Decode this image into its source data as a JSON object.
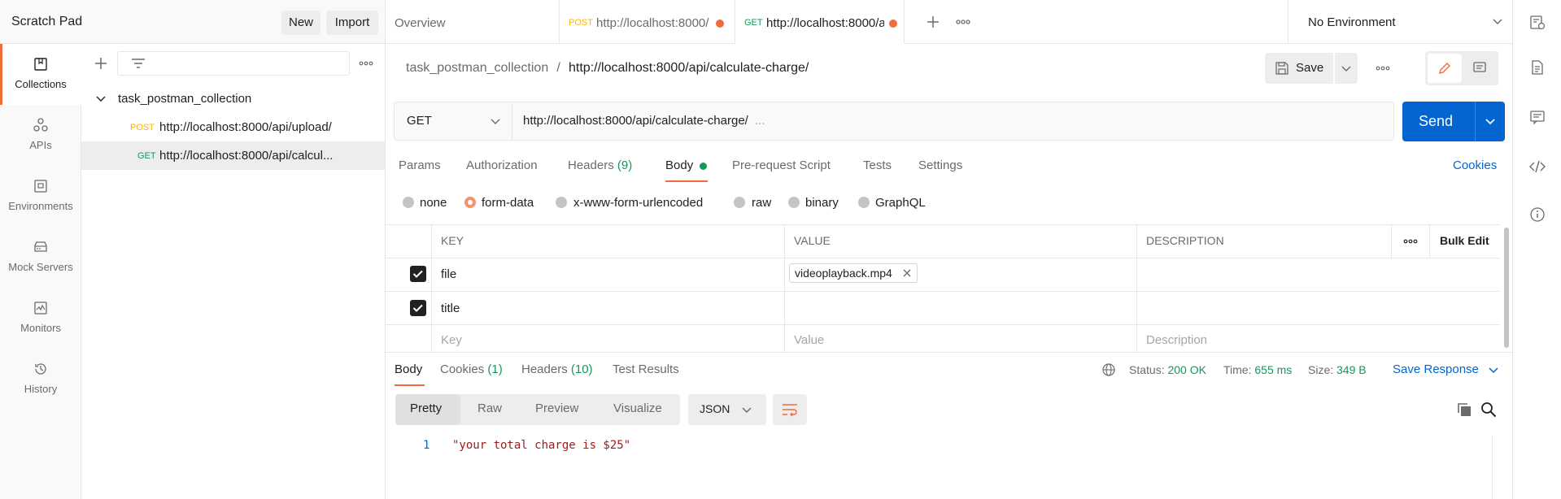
{
  "scratch": {
    "title": "Scratch Pad",
    "new_label": "New",
    "import_label": "Import"
  },
  "tabs": [
    {
      "label": "Overview"
    },
    {
      "method": "POST",
      "label": "http://localhost:8000/"
    },
    {
      "method": "GET",
      "label": "http://localhost:8000/a"
    }
  ],
  "environment": {
    "selected": "No Environment"
  },
  "rail": [
    {
      "label": "Collections",
      "icon": "collections-icon"
    },
    {
      "label": "APIs",
      "icon": "apis-icon"
    },
    {
      "label": "Environments",
      "icon": "environments-icon"
    },
    {
      "label": "Mock Servers",
      "icon": "mock-servers-icon"
    },
    {
      "label": "Monitors",
      "icon": "monitors-icon"
    },
    {
      "label": "History",
      "icon": "history-icon"
    }
  ],
  "sidebar": {
    "collection": "task_postman_collection",
    "requests": [
      {
        "method": "POST",
        "url": "http://localhost:8000/api/upload/"
      },
      {
        "method": "GET",
        "url": "http://localhost:8000/api/calcul..."
      }
    ]
  },
  "request": {
    "breadcrumb_collection": "task_postman_collection",
    "breadcrumb_sep": "/",
    "breadcrumb_name": "http://localhost:8000/api/calculate-charge/",
    "save_label": "Save",
    "method": "GET",
    "url": "http://localhost:8000/api/calculate-charge/",
    "url_more": "...",
    "send_label": "Send",
    "tabs": {
      "params": "Params",
      "authorization": "Authorization",
      "headers": "Headers",
      "headers_count": "(9)",
      "body": "Body",
      "prerequest": "Pre-request Script",
      "tests": "Tests",
      "settings": "Settings"
    },
    "cookies_label": "Cookies",
    "body_types": [
      "none",
      "form-data",
      "x-www-form-urlencoded",
      "raw",
      "binary",
      "GraphQL"
    ],
    "table": {
      "headers": {
        "key": "KEY",
        "value": "VALUE",
        "description": "DESCRIPTION",
        "bulk_edit": "Bulk Edit"
      },
      "rows": [
        {
          "key": "file",
          "value": "videoplayback.mp4"
        },
        {
          "key": "title",
          "value": ""
        }
      ],
      "placeholders": {
        "key": "Key",
        "value": "Value",
        "description": "Description"
      }
    }
  },
  "response": {
    "tabs": {
      "body": "Body",
      "cookies": "Cookies",
      "cookies_count": "(1)",
      "headers": "Headers",
      "headers_count": "(10)",
      "tests": "Test Results"
    },
    "status_label": "Status:",
    "status": "200 OK",
    "time_label": "Time:",
    "time": "655 ms",
    "size_label": "Size:",
    "size": "349 B",
    "save_response": "Save Response",
    "views": [
      "Pretty",
      "Raw",
      "Preview",
      "Visualize"
    ],
    "format": "JSON",
    "lines": [
      {
        "num": "1",
        "text": "\"your total charge is $25\""
      }
    ]
  },
  "colors": {
    "accent": "#f26b3a",
    "send": "#0265d2",
    "post": "#ffb400",
    "get": "#0f9a58",
    "string": "#a21a1a"
  }
}
